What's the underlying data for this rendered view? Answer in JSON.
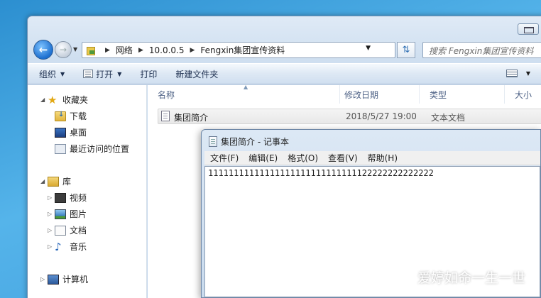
{
  "address": {
    "crumbs": [
      "网络",
      "10.0.0.5",
      "Fengxin集团宣传资料"
    ],
    "search_placeholder": "搜索 Fengxin集团宣传资料"
  },
  "toolbar": {
    "organize": "组织",
    "open": "打开",
    "print": "打印",
    "new_folder": "新建文件夹"
  },
  "nav": {
    "favorites": "收藏夹",
    "downloads": "下载",
    "desktop": "桌面",
    "recent": "最近访问的位置",
    "libraries": "库",
    "videos": "视频",
    "pictures": "图片",
    "documents": "文档",
    "music": "音乐",
    "computer": "计算机"
  },
  "columns": {
    "name": "名称",
    "modified": "修改日期",
    "type": "类型",
    "size": "大小"
  },
  "files": [
    {
      "name": "集团简介",
      "modified": "2018/5/27 19:00",
      "type": "文本文档"
    }
  ],
  "notepad": {
    "title": "集团简介 - 记事本",
    "menus": [
      "文件(F)",
      "编辑(E)",
      "格式(O)",
      "查看(V)",
      "帮助(H)"
    ],
    "content": "11111111111111111111111111111122222222222222"
  },
  "watermark": "爱婷如命一生一世"
}
